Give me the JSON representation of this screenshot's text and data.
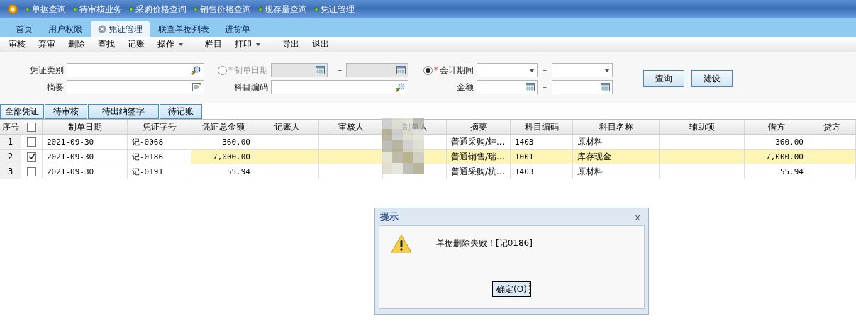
{
  "top_menu": [
    "单据查询",
    "待审核业务",
    "采购价格查询",
    "销售价格查询",
    "现存量查询",
    "凭证管理"
  ],
  "tabs": [
    {
      "label": "首页",
      "selected": false,
      "closable": false
    },
    {
      "label": "用户权限",
      "selected": false,
      "closable": false
    },
    {
      "label": "凭证管理",
      "selected": true,
      "closable": true
    },
    {
      "label": "联查单据列表",
      "selected": false,
      "closable": false
    },
    {
      "label": "进货单",
      "selected": false,
      "closable": false
    }
  ],
  "toolbar": [
    {
      "label": "审核",
      "dropdown": false
    },
    {
      "label": "弃审",
      "dropdown": false
    },
    {
      "label": "删除",
      "dropdown": false
    },
    {
      "label": "查找",
      "dropdown": false
    },
    {
      "label": "记账",
      "dropdown": false
    },
    {
      "label": "操作",
      "dropdown": true
    },
    {
      "label": "栏目",
      "dropdown": false
    },
    {
      "label": "打印",
      "dropdown": true
    },
    {
      "label": "导出",
      "dropdown": false
    },
    {
      "label": "退出",
      "dropdown": false
    }
  ],
  "filters": {
    "required_mark": "*",
    "voucher_type": "凭证类别",
    "summary": "摘要",
    "date_radio": {
      "label": "制单日期",
      "selected": false
    },
    "account_code": "科目编码",
    "period_radio": {
      "label": "会计期间",
      "selected": true
    },
    "amount": "金额",
    "range_sep": "–"
  },
  "filter_buttons": [
    "查询",
    "滤设"
  ],
  "view_tabs": [
    {
      "label": "全部凭证",
      "selected": true
    },
    {
      "label": "待审核",
      "selected": false
    },
    {
      "label": "待出纳签字",
      "selected": false
    },
    {
      "label": "待记账",
      "selected": false
    }
  ],
  "table": {
    "select_all_checked": false,
    "columns": [
      "序号",
      "制单日期",
      "凭证字号",
      "凭证总金额",
      "记账人",
      "审核人",
      "制单人",
      "摘要",
      "科目编码",
      "科目名称",
      "辅助项",
      "借方",
      "贷方"
    ],
    "rows": [
      {
        "index": "1",
        "checked": false,
        "selected": false,
        "date": "2021-09-30",
        "voucher_no": "记-0068",
        "total": "360.00",
        "summary": "普通采购/蚌...",
        "code": "1403",
        "name": "原材料",
        "debit": "360.00"
      },
      {
        "index": "2",
        "checked": true,
        "selected": true,
        "date": "2021-09-30",
        "voucher_no": "记-0186",
        "total": "7,000.00",
        "summary": "普通销售/瑞...",
        "code": "1001",
        "name": "库存现金",
        "debit": "7,000.00"
      },
      {
        "index": "3",
        "checked": false,
        "selected": false,
        "date": "2021-09-30",
        "voucher_no": "记-0191",
        "total": "55.94",
        "summary": "普通采购/杭...",
        "code": "1403",
        "name": "原材料",
        "debit": "55.94"
      }
    ]
  },
  "dialog": {
    "title": "提示",
    "close": "x",
    "message": "单据删除失败！[记0186]",
    "button": "确定(O)"
  }
}
